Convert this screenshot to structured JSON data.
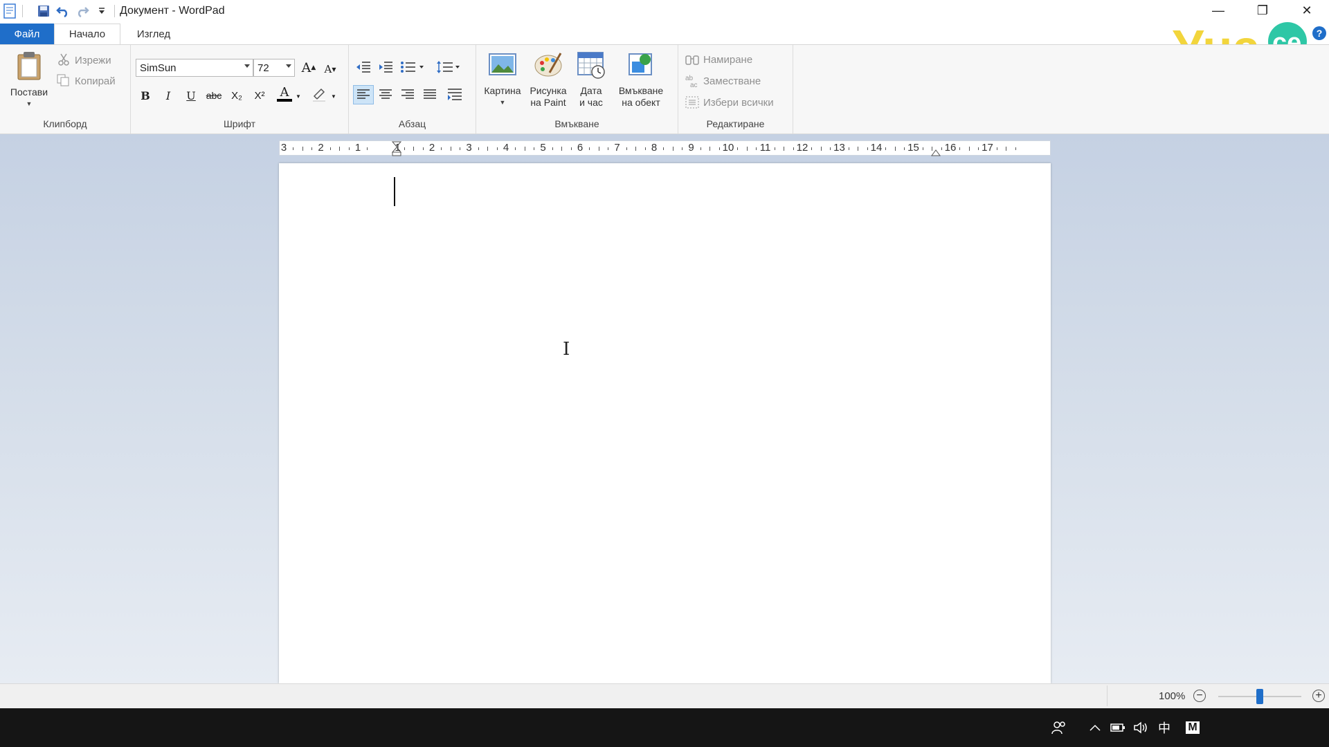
{
  "window": {
    "title": "Документ - WordPad",
    "minimize": "—",
    "restore": "❐",
    "close": "✕"
  },
  "tabs": [
    {
      "label": "Файл"
    },
    {
      "label": "Начало"
    },
    {
      "label": "Изглед"
    }
  ],
  "ribbon": {
    "clipboard": {
      "label": "Клипборд",
      "paste": "Постави",
      "cut": "Изрежи",
      "copy": "Копирай"
    },
    "font": {
      "label": "Шрифт",
      "family": "SimSun",
      "size": "72",
      "bold": "B",
      "italic": "I",
      "underline": "U",
      "strikethrough": "abc",
      "subscript": "X₂",
      "superscript": "X²",
      "grow": "A",
      "shrink": "A",
      "font_color": "A",
      "font_color_hex": "#000000",
      "highlight_hex": "#ffffff"
    },
    "paragraph": {
      "label": "Абзац"
    },
    "insert": {
      "label": "Вмъкване",
      "picture": "Картина",
      "paint": [
        "Рисунка",
        "на Paint"
      ],
      "datetime": [
        "Дата",
        "и час"
      ],
      "object": [
        "Вмъкване",
        "на обект"
      ]
    },
    "editing": {
      "label": "Редактиране",
      "find": "Намиране",
      "replace": "Заместване",
      "select_all": "Избери всички"
    }
  },
  "ruler": {
    "labels": [
      "3",
      "2",
      "1",
      "1",
      "2",
      "3",
      "4",
      "5",
      "6",
      "7",
      "8",
      "9",
      "10",
      "11",
      "12",
      "13",
      "14",
      "15",
      "16",
      "17"
    ]
  },
  "statusbar": {
    "zoom": "100%",
    "zoom_level": 0.5,
    "zoom_out": "−",
    "zoom_in": "+"
  },
  "logo": {
    "text": "Уча",
    "badge": "се",
    "color": "#f2d53c",
    "badge_color": "#2ec7a6"
  },
  "help": "?",
  "taskbar": {
    "ime": "中",
    "lang": "M"
  },
  "colors": {
    "accent": "#1f6ec9",
    "taskbar": "#151515"
  }
}
